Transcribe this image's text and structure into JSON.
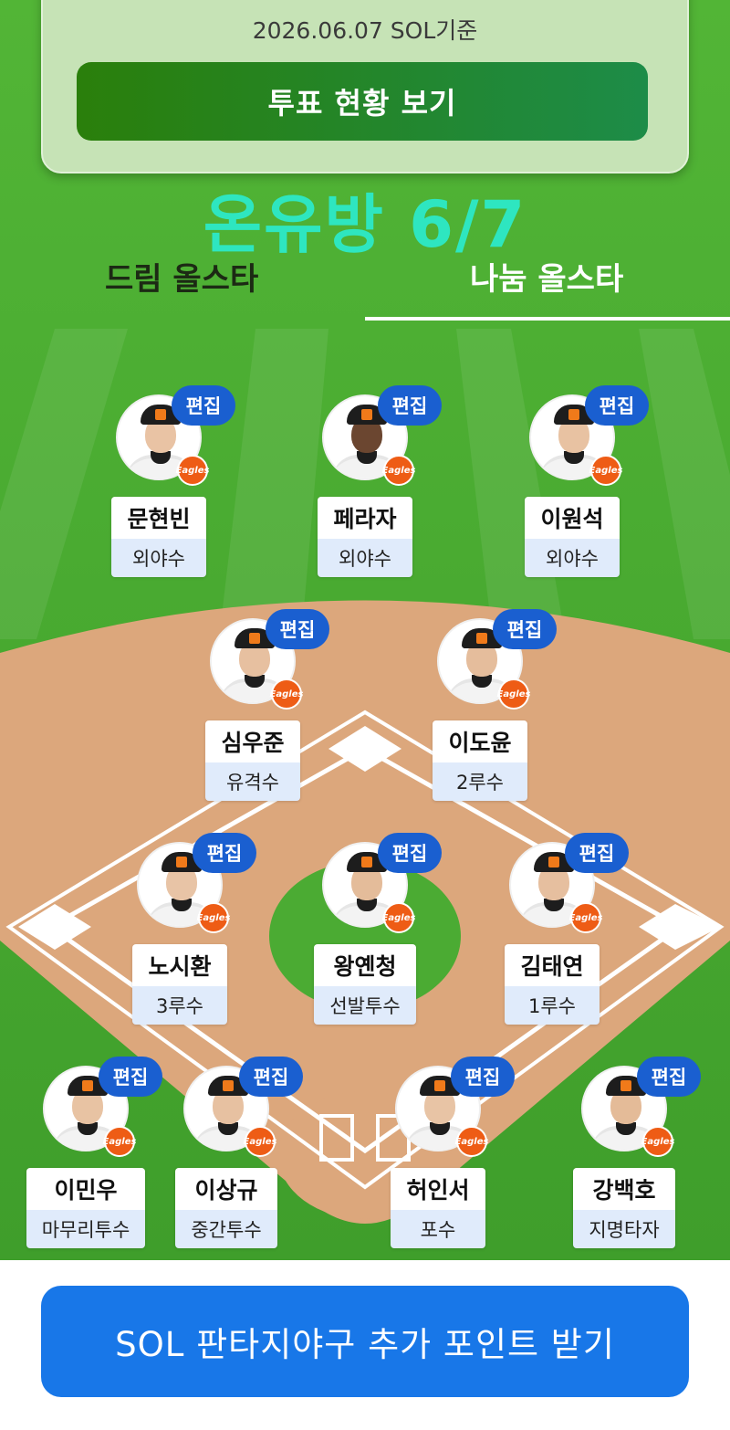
{
  "header": {
    "date_text": "2026.06.07 SOL기준",
    "vote_button_label": "투표 현황 보기"
  },
  "headline": "온유방 6/7",
  "tabs": [
    {
      "label": "드림 올스타"
    },
    {
      "label": "나눔 올스타"
    }
  ],
  "edit_label": "편집",
  "team_logo_text": "Eagles",
  "players": [
    {
      "name": "문현빈",
      "position": "외야수"
    },
    {
      "name": "페라자",
      "position": "외야수"
    },
    {
      "name": "이원석",
      "position": "외야수"
    },
    {
      "name": "심우준",
      "position": "유격수"
    },
    {
      "name": "이도윤",
      "position": "2루수"
    },
    {
      "name": "노시환",
      "position": "3루수"
    },
    {
      "name": "왕옌청",
      "position": "선발투수"
    },
    {
      "name": "김태연",
      "position": "1루수"
    },
    {
      "name": "이민우",
      "position": "마무리투수"
    },
    {
      "name": "이상규",
      "position": "중간투수"
    },
    {
      "name": "허인서",
      "position": "포수"
    },
    {
      "name": "강백호",
      "position": "지명타자"
    }
  ],
  "bottom_button_label": "SOL 판타지야구 추가 포인트 받기",
  "colors": {
    "grass": "#4cae33",
    "infield_dirt": "#dca77c",
    "edit_button": "#1a5fd0",
    "cta_button": "#1877e8",
    "headline": "#2ee6c0",
    "team_logo": "#ee5c15"
  }
}
